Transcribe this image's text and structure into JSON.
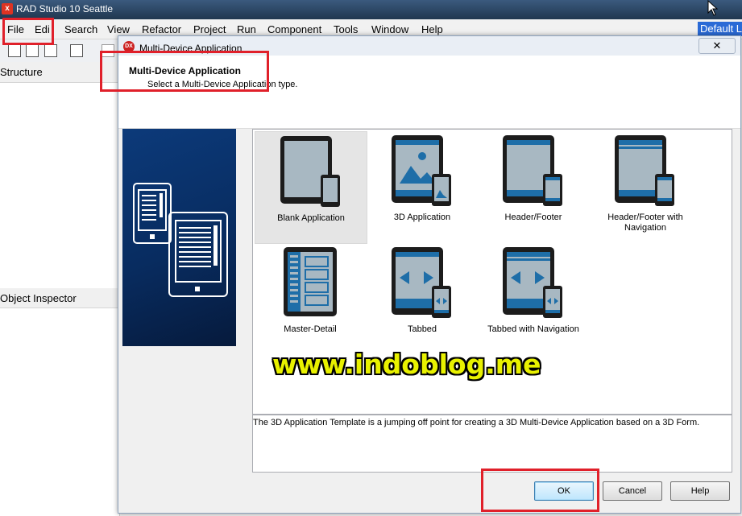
{
  "ide": {
    "title": "RAD Studio 10 Seattle",
    "logo_text": "x",
    "menus": [
      "File",
      "Edi",
      "Search",
      "View",
      "Refactor",
      "Project",
      "Run",
      "Component",
      "Tools",
      "Window",
      "Help"
    ],
    "layout_combo": "Default La",
    "structure_title": "Structure",
    "object_inspector_title": "Object Inspector"
  },
  "dialog": {
    "title": "Multi-Device Application",
    "icon_text": "DX",
    "close_label": "✕",
    "header_title": "Multi-Device Application",
    "header_subtitle": "Select a Multi-Device Application type.",
    "templates": [
      {
        "label": "Blank Application",
        "icon": "blank-app-icon",
        "selected": true
      },
      {
        "label": "3D Application",
        "icon": "3d-app-icon",
        "selected": false
      },
      {
        "label": "Header/Footer",
        "icon": "header-footer-icon",
        "selected": false
      },
      {
        "label": "Header/Footer with Navigation",
        "icon": "header-footer-nav-icon",
        "selected": false
      },
      {
        "label": "Master-Detail",
        "icon": "master-detail-icon",
        "selected": false
      },
      {
        "label": "Tabbed",
        "icon": "tabbed-icon",
        "selected": false
      },
      {
        "label": "Tabbed with Navigation",
        "icon": "tabbed-nav-icon",
        "selected": false
      }
    ],
    "description": "The 3D Application Template is a jumping off point for creating a 3D Multi-Device Application based on a 3D Form.",
    "buttons": {
      "ok": "OK",
      "cancel": "Cancel",
      "help": "Help"
    }
  },
  "watermark": "www.indoblog.me",
  "colors": {
    "highlight_box": "#e0202a",
    "watermark": "#e8f100",
    "banner": "#0c3a7a",
    "device_screen": "#1e6ea8"
  }
}
